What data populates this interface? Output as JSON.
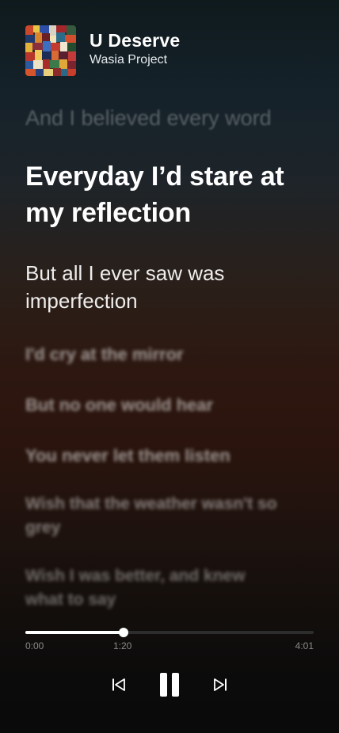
{
  "song": {
    "title": "U Deserve",
    "artist": "Wasia Project"
  },
  "lyrics": {
    "previous": "And I believed every word",
    "current": "Everyday I’d stare at my reflection",
    "next": "But all I ever saw was imperfection",
    "upcoming": [
      "I'd cry at the mirror",
      "But no one would hear",
      "You never let them listen",
      "Wish that the weather wasn't so grey",
      "Wish I was better, and knew what to say"
    ]
  },
  "player": {
    "start_time": "0:00",
    "current_time": "1:20",
    "end_time": "4:01",
    "progress": 0.34,
    "prev_icon": "skip-previous-icon",
    "play_state_icon": "pause-icon",
    "next_icon": "skip-next-icon"
  },
  "colors": {
    "accent": "#ffffff",
    "track": "#2d2d2d",
    "time_text": "#8a8a8a",
    "background_top": "#0f1a1d",
    "background_mid": "#2d1710",
    "background_bottom": "#0a0a0a"
  }
}
